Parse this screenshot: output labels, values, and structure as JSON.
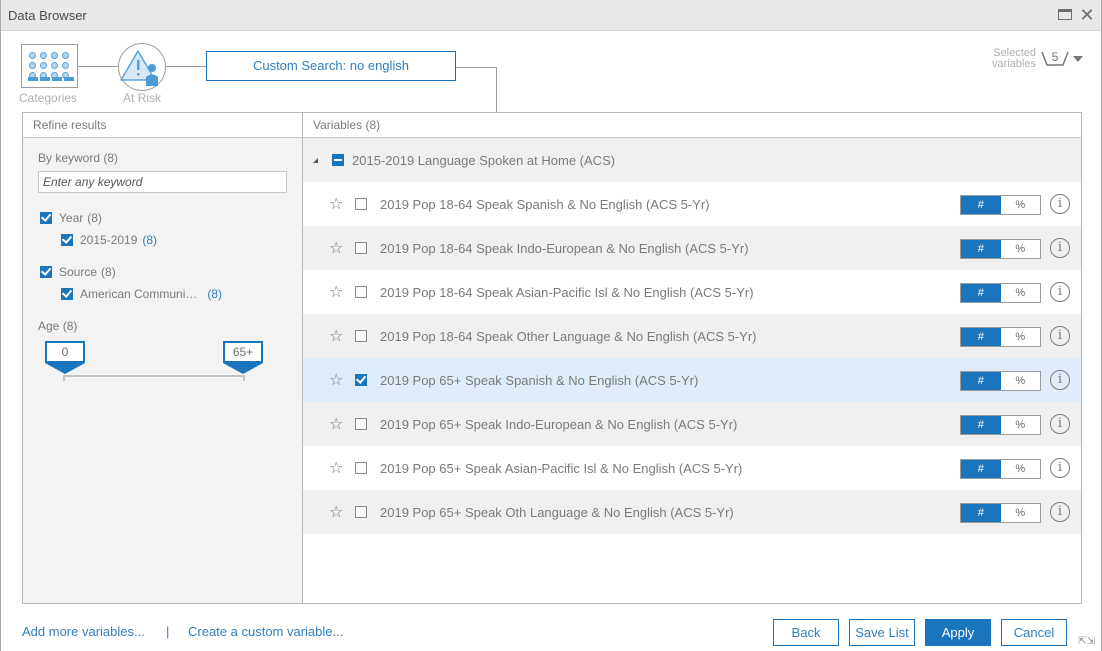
{
  "window": {
    "title": "Data Browser"
  },
  "workflow": {
    "steps": [
      {
        "label": "Categories",
        "icon": "categories-grid-icon"
      },
      {
        "label": "At Risk",
        "icon": "at-risk-warning-icon"
      }
    ],
    "current": "Custom Search: no english"
  },
  "selected_variables": {
    "label_line1": "Selected",
    "label_line2": "variables",
    "count": "5"
  },
  "refine": {
    "header": "Refine results",
    "keyword": {
      "label": "By keyword",
      "count": "(8)",
      "placeholder": "Enter any keyword",
      "value": ""
    },
    "filters": [
      {
        "label": "Year",
        "count": "(8)",
        "checked": true,
        "children": [
          {
            "label": "2015-2019",
            "count": "(8)",
            "checked": true
          }
        ]
      },
      {
        "label": "Source",
        "count": "(8)",
        "checked": true,
        "children": [
          {
            "label": "American Communi…",
            "count": "(8)",
            "checked": true
          }
        ]
      }
    ],
    "age": {
      "label": "Age",
      "count": "(8)",
      "min": "0",
      "max": "65+"
    }
  },
  "variables": {
    "header": "Variables (8)",
    "group": {
      "label": "2015-2019 Language Spoken at Home (ACS)",
      "state": "partial",
      "expanded": true
    },
    "items": [
      {
        "label": "2019 Pop 18-64 Speak Spanish & No English (ACS 5-Yr)",
        "checked": false,
        "mode": "#"
      },
      {
        "label": "2019 Pop 18-64 Speak Indo-European & No English (ACS 5-Yr)",
        "checked": false,
        "mode": "#"
      },
      {
        "label": "2019 Pop 18-64 Speak Asian-Pacific Isl & No English (ACS 5-Yr)",
        "checked": false,
        "mode": "#"
      },
      {
        "label": "2019 Pop 18-64 Speak Other Language & No English (ACS 5-Yr)",
        "checked": false,
        "mode": "#"
      },
      {
        "label": "2019 Pop 65+ Speak Spanish & No English (ACS 5-Yr)",
        "checked": true,
        "mode": "#"
      },
      {
        "label": "2019 Pop 65+ Speak Indo-European & No English (ACS 5-Yr)",
        "checked": false,
        "mode": "#"
      },
      {
        "label": "2019 Pop 65+ Speak Asian-Pacific Isl & No English (ACS 5-Yr)",
        "checked": false,
        "mode": "#"
      },
      {
        "label": "2019 Pop 65+ Speak Oth Language & No English (ACS 5-Yr)",
        "checked": false,
        "mode": "#"
      }
    ],
    "toggle_labels": [
      "#",
      "%"
    ]
  },
  "footer": {
    "add_more": "Add more variables...",
    "separator": "|",
    "create_custom": "Create a custom variable...",
    "back": "Back",
    "save_list": "Save List",
    "apply": "Apply",
    "cancel": "Cancel"
  },
  "colors": {
    "accent": "#1b75bc",
    "link": "#2f7fc1",
    "selected_row": "#deedf9",
    "alt_row": "#f0f0f0"
  }
}
